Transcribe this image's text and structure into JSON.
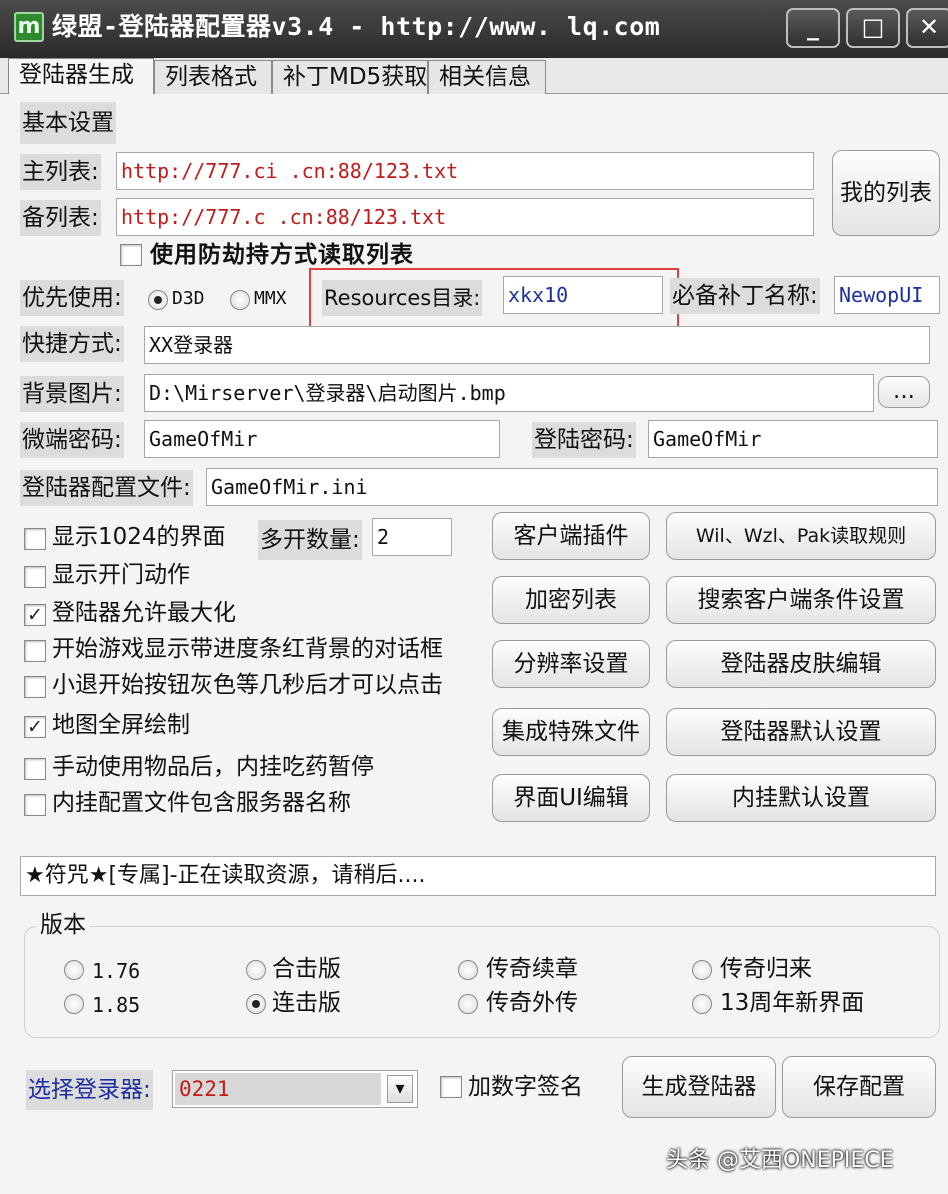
{
  "window": {
    "logo_char": "m",
    "title": "绿盟-登陆器配置器v3.4 - http://www.      lq.com",
    "minimize": "_",
    "maximize": "□",
    "close": "✕"
  },
  "tabs": [
    "登陆器生成",
    "列表格式",
    "补丁MD5获取",
    "相关信息"
  ],
  "basic": {
    "section_label": "基本设置",
    "main_list_label": "主列表:",
    "main_list_value": "http://777.ci     .cn:88/123.txt",
    "backup_list_label": "备列表:",
    "backup_list_value": "http://777.c      .cn:88/123.txt",
    "my_list_button": "我的列表",
    "anti_hijack_label": "使用防劫持方式读取列表",
    "priority_label": "优先使用:",
    "priority_options": [
      "D3D",
      "MMX"
    ],
    "resources_label": "Resources目录:",
    "resources_value": "xkx10",
    "patch_label": "必备补丁名称:",
    "patch_value": "NewopUI",
    "shortcut_label": "快捷方式:",
    "shortcut_value": "XX登录器",
    "bg_label": "背景图片:",
    "bg_value": "D:\\Mirserver\\登录器\\启动图片.bmp",
    "browse_button": "...",
    "micro_pwd_label": "微端密码:",
    "micro_pwd_value": "GameOfMir",
    "login_pwd_label": "登陆密码:",
    "login_pwd_value": "GameOfMir",
    "config_file_label": "登陆器配置文件:",
    "config_file_value": "GameOfMir.ini"
  },
  "options": {
    "multi_label": "多开数量:",
    "multi_value": "2",
    "checkboxes": [
      {
        "label": "显示1024的界面",
        "checked": false
      },
      {
        "label": "显示开门动作",
        "checked": false
      },
      {
        "label": "登陆器允许最大化",
        "checked": true
      },
      {
        "label": "开始游戏显示带进度条红背景的对话框",
        "checked": false
      },
      {
        "label": "小退开始按钮灰色等几秒后才可以点击",
        "checked": false
      },
      {
        "label": "地图全屏绘制",
        "checked": true
      },
      {
        "label": "手动使用物品后，内挂吃药暂停",
        "checked": false
      },
      {
        "label": "内挂配置文件包含服务器名称",
        "checked": false
      }
    ],
    "check_mark": "✓"
  },
  "buttons": {
    "client_plugin": "客户端插件",
    "wil_rules": "Wil、Wzl、Pak读取规则",
    "encrypt_list": "加密列表",
    "search_client": "搜索客户端条件设置",
    "resolution": "分辨率设置",
    "skin_edit": "登陆器皮肤编辑",
    "special_files": "集成特殊文件",
    "default_settings": "登陆器默认设置",
    "ui_edit": "界面UI编辑",
    "plugin_default": "内挂默认设置"
  },
  "status_text": "★符咒★[专属]-正在读取资源，请稍后....",
  "version": {
    "label": "版本",
    "options": [
      {
        "label": "1.76",
        "selected": false
      },
      {
        "label": "合击版",
        "selected": false
      },
      {
        "label": "传奇续章",
        "selected": false
      },
      {
        "label": "传奇归来",
        "selected": false
      },
      {
        "label": "1.85",
        "selected": false
      },
      {
        "label": "连击版",
        "selected": true
      },
      {
        "label": "传奇外传",
        "selected": false
      },
      {
        "label": "13周年新界面",
        "selected": false
      }
    ]
  },
  "footer": {
    "select_label": "选择登录器:",
    "select_value": "0221",
    "dropdown_arrow": "▾",
    "digital_sign_label": "加数字签名",
    "generate_button": "生成登陆器",
    "save_button": "保存配置",
    "watermark": "头条 @艾西ONEPIECE"
  }
}
